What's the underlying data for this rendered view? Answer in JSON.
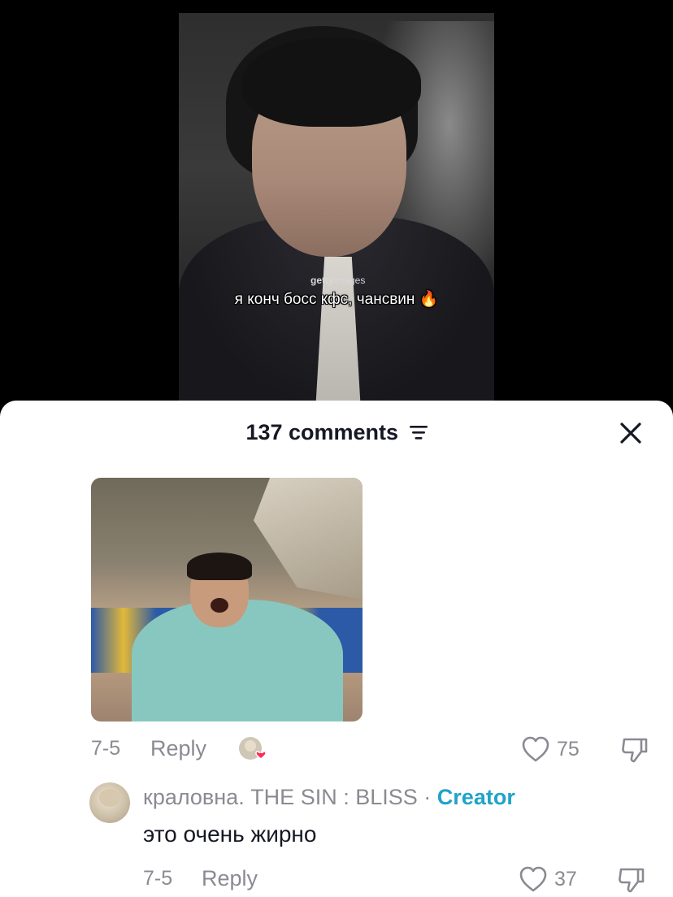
{
  "video": {
    "watermark_bold": "getty",
    "watermark_rest": "images",
    "caption": "я конч босс кфс, чансвин 🔥"
  },
  "sheet": {
    "comment_count_label": "137 comments",
    "filter_icon": "filter-icon",
    "close_icon": "close-icon"
  },
  "comments": [
    {
      "type": "image",
      "date": "7-5",
      "reply_label": "Reply",
      "likes": "75",
      "liked_by_creator": true
    },
    {
      "username": "краловна. THE SIN : BLISS",
      "separator": "·",
      "badge": "Creator",
      "text": "это очень жирно",
      "date": "7-5",
      "reply_label": "Reply",
      "likes": "37"
    }
  ],
  "colors": {
    "creator_badge": "#20a3c9",
    "heart": "#fe2c55",
    "muted": "#8a8b91",
    "text": "#161823"
  }
}
